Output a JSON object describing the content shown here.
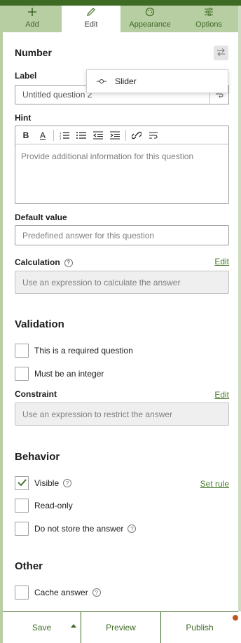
{
  "tabs": [
    {
      "label": "Add",
      "icon": "plus-icon"
    },
    {
      "label": "Edit",
      "icon": "pencil-icon"
    },
    {
      "label": "Appearance",
      "icon": "palette-icon"
    },
    {
      "label": "Options",
      "icon": "sliders-icon"
    }
  ],
  "active_tab": "Edit",
  "question": {
    "type_title": "Number",
    "label_label": "Label",
    "label_value": "Untitled question 2",
    "hint_label": "Hint",
    "hint_placeholder": "Provide additional information for this question",
    "default_label": "Default value",
    "default_placeholder": "Predefined answer for this question",
    "calculation_label": "Calculation",
    "calculation_edit": "Edit",
    "calculation_placeholder": "Use an expression to calculate the answer"
  },
  "popover": {
    "item": "Slider"
  },
  "validation": {
    "title": "Validation",
    "required": "This is a required question",
    "integer": "Must be an integer",
    "constraint_label": "Constraint",
    "constraint_edit": "Edit",
    "constraint_placeholder": "Use an expression to restrict the answer"
  },
  "behavior": {
    "title": "Behavior",
    "visible": "Visible",
    "set_rule": "Set rule",
    "readonly": "Read-only",
    "do_not_store": "Do not store the answer"
  },
  "other": {
    "title": "Other",
    "cache": "Cache answer"
  },
  "footer": {
    "save": "Save",
    "preview": "Preview",
    "publish": "Publish"
  },
  "colors": {
    "brand": "#3d6b24",
    "tab_bg": "#b7cda2",
    "notification": "#c0561c"
  }
}
